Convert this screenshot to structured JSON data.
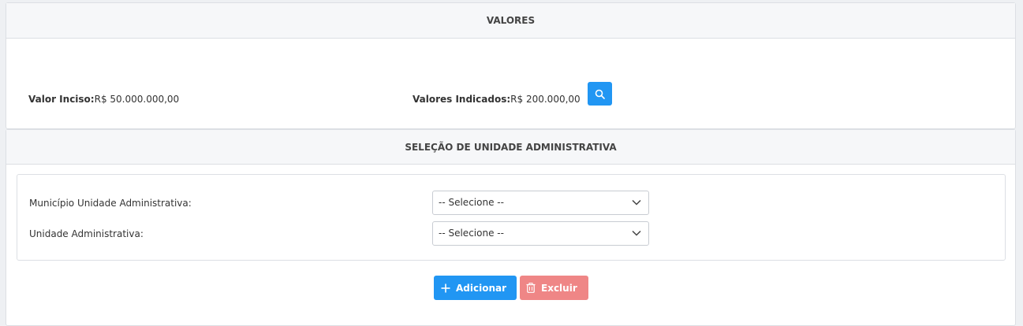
{
  "valores": {
    "header": "VALORES",
    "inciso_label": "Valor Inciso:",
    "inciso_value": "R$ 50.000.000,00",
    "indicados_label": "Valores Indicados:",
    "indicados_value": "R$ 200.000,00",
    "search_icon": "search-icon"
  },
  "selecao": {
    "header": "SELEÇÃO DE UNIDADE ADMINISTRATIVA",
    "municipio_label": "Município Unidade Administrativa:",
    "municipio_value": "-- Selecione --",
    "unidade_label": "Unidade Administrativa:",
    "unidade_value": "-- Selecione --",
    "add_label": "Adicionar",
    "delete_label": "Excluir"
  },
  "colors": {
    "primary": "#2196f3",
    "danger_disabled": "#ef8686"
  }
}
